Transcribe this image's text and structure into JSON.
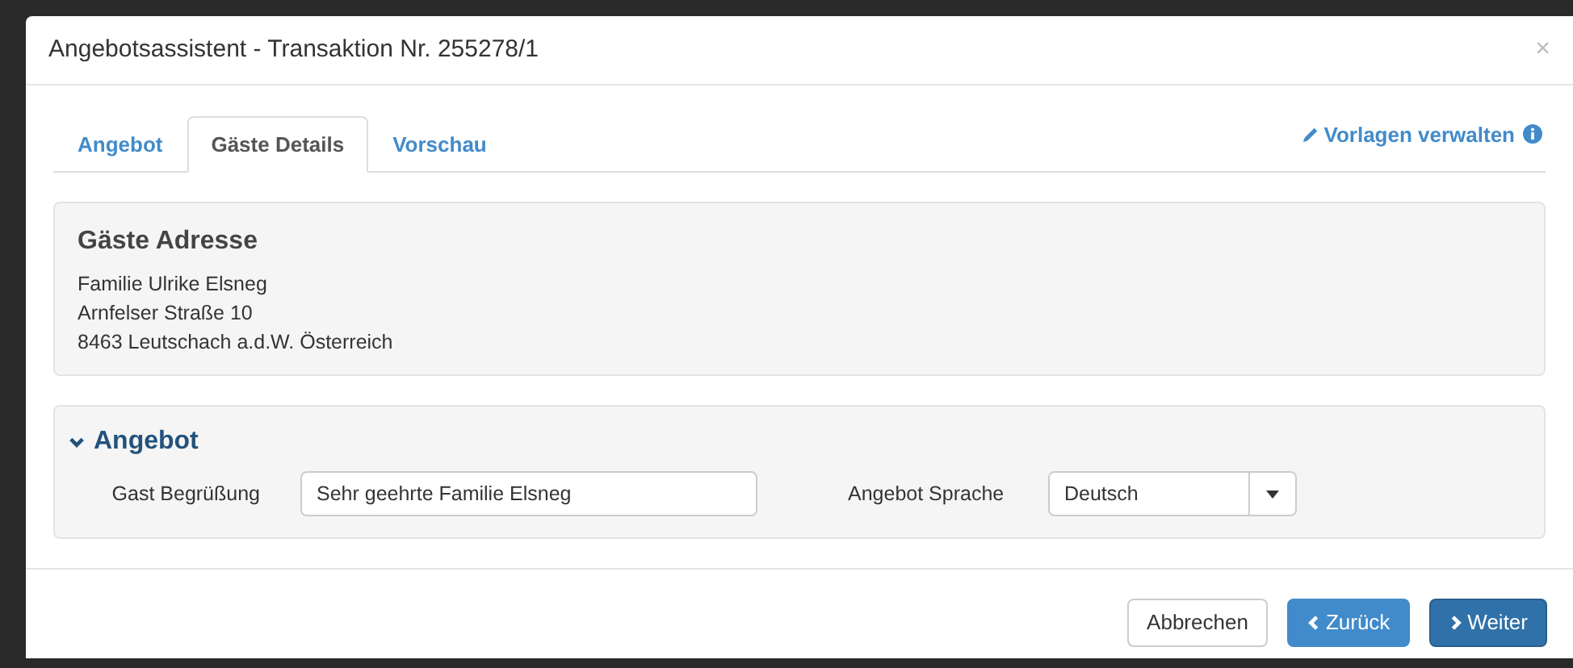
{
  "window": {
    "title": "Angebotsassistent - Transaktion Nr. 255278/1",
    "close": "×"
  },
  "tabs": [
    {
      "label": "Angebot",
      "selected": false
    },
    {
      "label": "Gäste Details",
      "selected": true
    },
    {
      "label": "Vorschau",
      "selected": false
    }
  ],
  "manage_templates_link": "Vorlagen verwalten",
  "address": {
    "heading": "Gäste Adresse",
    "lines": [
      "Familie Ulrike Elsneg",
      "Arnfelser Straße 10",
      "8463 Leutschach a.d.W. Österreich"
    ]
  },
  "offer_section": {
    "heading": "Angebot",
    "expanded": true,
    "greeting": {
      "label": "Gast Begrüßung",
      "value": "Sehr geehrte Familie Elsneg"
    },
    "language": {
      "label": "Angebot Sprache",
      "value": "Deutsch"
    }
  },
  "buttons": [
    {
      "label": "Abbrechen",
      "kind": "cancel"
    },
    {
      "label": "Zurück",
      "kind": "back"
    },
    {
      "label": "Weiter",
      "kind": "next"
    }
  ]
}
